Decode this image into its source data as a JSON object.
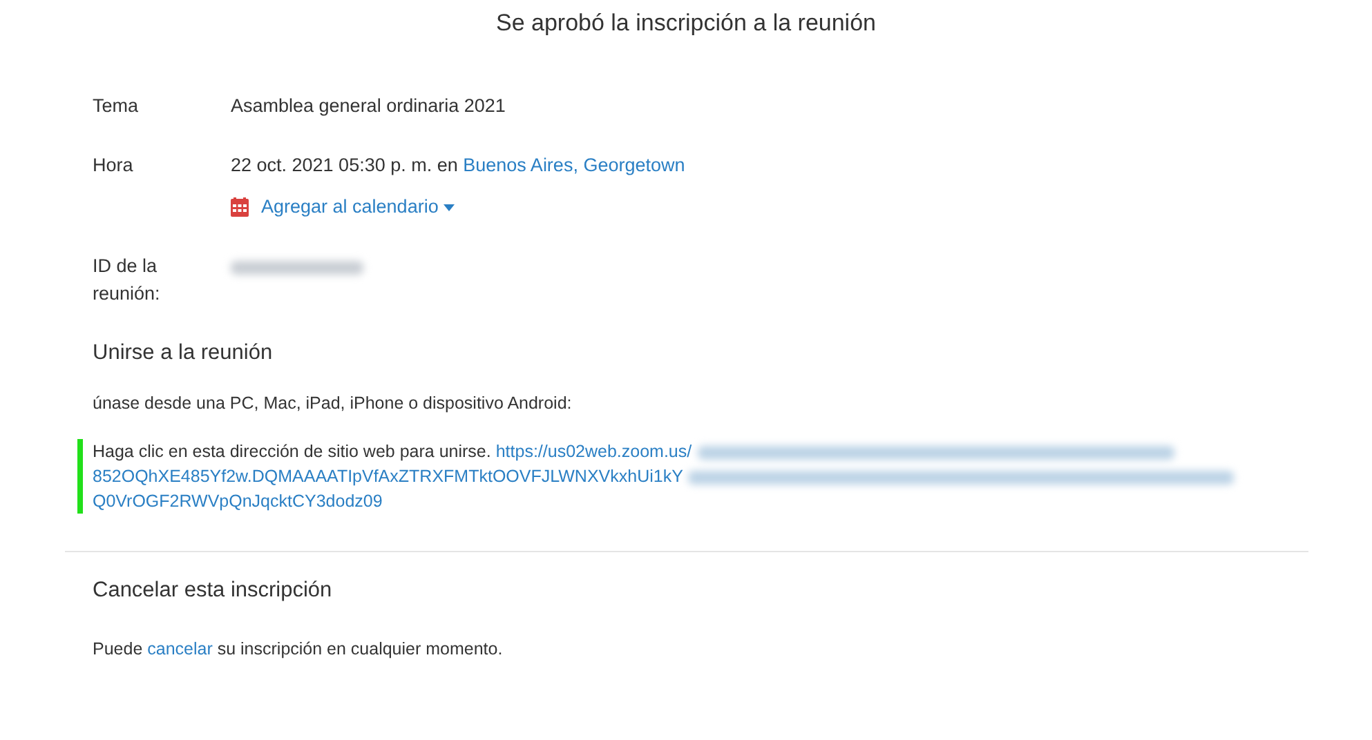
{
  "title": "Se aprobó la inscripción a la reunión",
  "details": [
    {
      "label": "Tema",
      "kind": "text",
      "value": "Asamblea general ordinaria 2021"
    },
    {
      "label": "Hora",
      "kind": "time",
      "value": "22 oct. 2021 05:30 p. m. en",
      "link": "Buenos Aires, Georgetown",
      "calendar": "Agregar al calendario"
    },
    {
      "label": "ID de la reunión:",
      "kind": "hidden"
    }
  ],
  "join": {
    "heading": "Unirse a la reunión",
    "devices": "únase desde una PC, Mac, iPad, iPhone o dispositivo Android:",
    "intro": "Haga clic en esta dirección de sitio web para unirse.",
    "url_parts": [
      "https://us02web.zoom.us/",
      "852OQhXE485Yf2w.DQMAAAATIpVfAxZTRXFMTktOOVFJLWNXVkxhUi1kY",
      "Q0VrOGF2RWVpQnJqcktCY3dodz09"
    ],
    "highlighted": true
  },
  "cancel": {
    "heading": "Cancelar esta inscripción",
    "before": "Puede",
    "link": "cancelar",
    "after": "su inscripción en cualquier momento."
  }
}
